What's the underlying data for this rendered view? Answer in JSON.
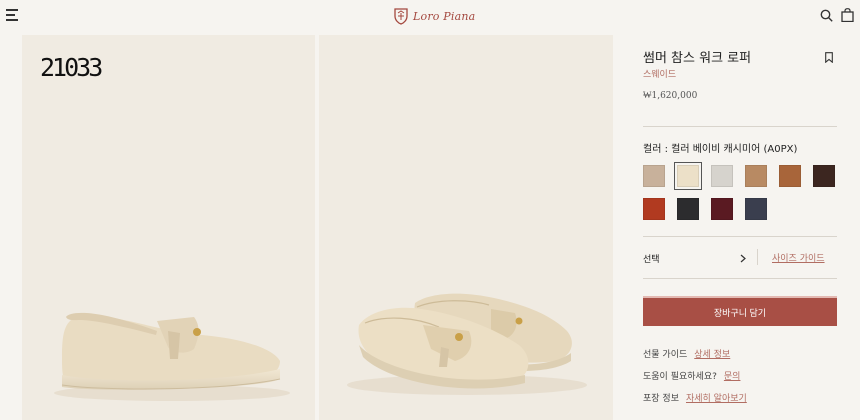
{
  "header": {
    "brand": "Loro Piana",
    "icons": {
      "menu": "menu-icon",
      "search": "search-icon",
      "bag": "shopping-bag-icon"
    }
  },
  "gallery": {
    "image_code": "21033",
    "images": [
      "beige-loafer-side-view",
      "beige-loafer-pair-view"
    ]
  },
  "product": {
    "title": "썸머 참스 워크 로퍼",
    "material": "스웨이드",
    "price": "₩1,620,000",
    "color_label": "컬러 : 컬러 베이비 캐시미어 (A0PX)",
    "swatches": [
      {
        "color": "#c8b19b",
        "selected": false
      },
      {
        "color": "#ece0c8",
        "selected": true
      },
      {
        "color": "#d6d3cd",
        "selected": false
      },
      {
        "color": "#b88a63",
        "selected": false
      },
      {
        "color": "#a8653a",
        "selected": false
      },
      {
        "color": "#3c2620",
        "selected": false
      },
      {
        "color": "#b13a20",
        "selected": false
      },
      {
        "color": "#2c2c2e",
        "selected": false
      },
      {
        "color": "#5a1a22",
        "selected": false
      },
      {
        "color": "#3a3e4e",
        "selected": false
      }
    ],
    "select_label": "선택",
    "size_guide": "사이즈 가이드",
    "cart_button": "장바구니 담기",
    "gift_label": "선물 가이드",
    "gift_link": "상세 정보",
    "help_label": "도움이 필요하세요?",
    "help_link": "문의",
    "packaging_label": "포장 정보",
    "packaging_link": "자세히 알아보기"
  }
}
